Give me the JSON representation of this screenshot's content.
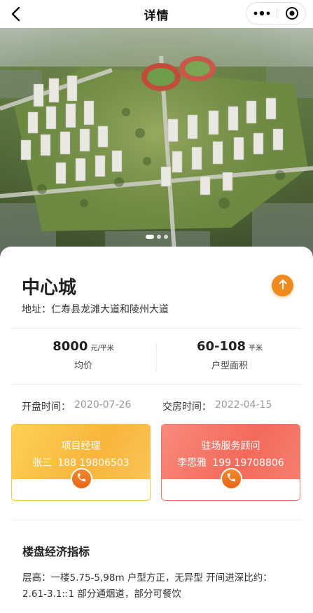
{
  "nav": {
    "title": "详情",
    "back_icon": "chevron-left-icon",
    "more_icon": "more-dots-icon",
    "close_icon": "target-close-icon"
  },
  "banner": {
    "slides": 3,
    "active_slide": 1
  },
  "property": {
    "name": "中心城",
    "address": "地址：仁寿县龙滩大道和陵州大道",
    "share_icon": "share-up-arrow-icon"
  },
  "stats": [
    {
      "value": "8000",
      "unit": "元/平米",
      "label": "均价"
    },
    {
      "value": "60-108",
      "unit": "平米",
      "label": "户型面积"
    }
  ],
  "dates": {
    "open_label": "开盘时间：",
    "open_value": "2020-07-26",
    "delivery_label": "交房时间：",
    "delivery_value": "2022-04-15"
  },
  "contacts": [
    {
      "role": "项目经理",
      "name": "张三",
      "phone": "188 19806503",
      "color": "#f8b53b"
    },
    {
      "role": "驻场服务顾问",
      "name": "李思雅",
      "phone": "199 19708806",
      "color": "#f36a5b"
    }
  ],
  "economics": {
    "title": "楼盘经济指标",
    "text": "层高：一楼5.75-5,98m 户型方正，无异型 开间进深比约：2.61-3.1::1 部分通烟道，部分可餐饮"
  },
  "colors": {
    "accent_orange": "#f08a1f",
    "date_gray": "#9a9a9a"
  }
}
